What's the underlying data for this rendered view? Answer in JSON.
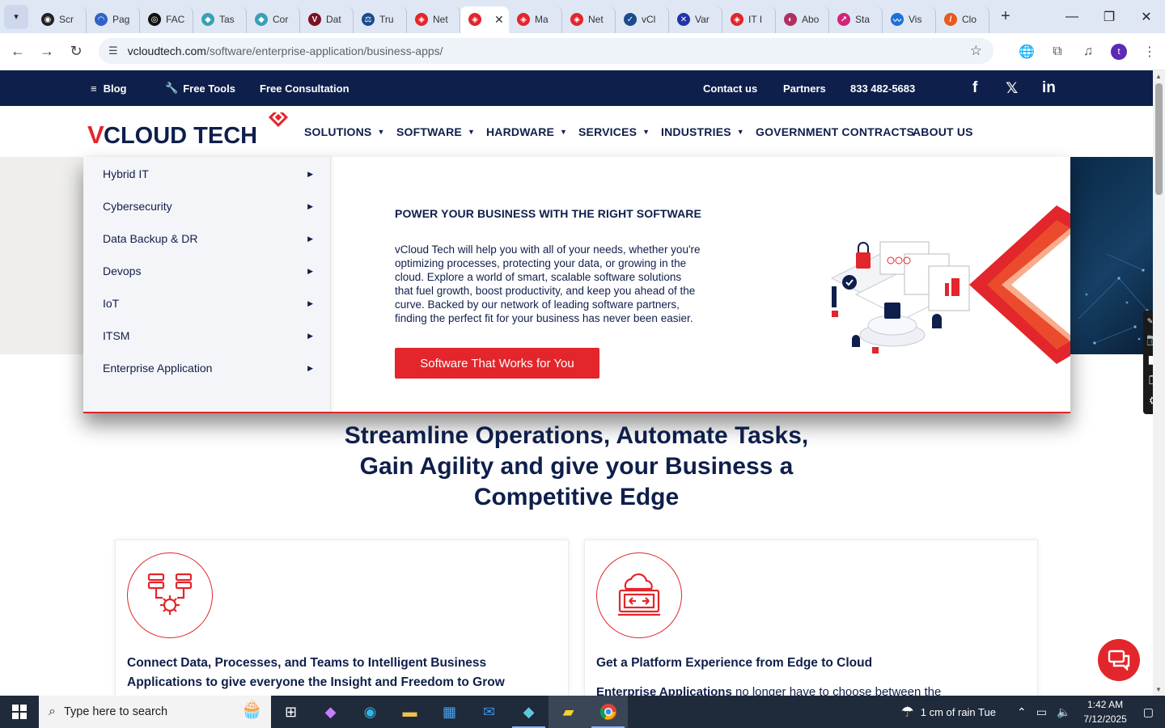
{
  "browser": {
    "tabs": [
      {
        "label": "Scr",
        "color": "#222222",
        "glyph": "◉"
      },
      {
        "label": "Pag",
        "color": "#2f63c9",
        "glyph": "◠"
      },
      {
        "label": "FAC",
        "color": "#111111",
        "glyph": "◎"
      },
      {
        "label": "Tas",
        "color": "#3aa0b5",
        "glyph": "◆"
      },
      {
        "label": "Cor",
        "color": "#3aa0b5",
        "glyph": "◆"
      },
      {
        "label": "Dat",
        "color": "#7a1022",
        "glyph": "V"
      },
      {
        "label": "Tru",
        "color": "#1a4b8c",
        "glyph": "⚖"
      },
      {
        "label": "Net",
        "color": "#e2262b",
        "glyph": "◈"
      },
      {
        "label": "",
        "color": "#e2262b",
        "glyph": "◈",
        "active": true
      },
      {
        "label": "Ma",
        "color": "#e2262b",
        "glyph": "◈"
      },
      {
        "label": "Net",
        "color": "#e2262b",
        "glyph": "◈"
      },
      {
        "label": "vCl",
        "color": "#1a4b8c",
        "glyph": "✓"
      },
      {
        "label": "Var",
        "color": "#2233aa",
        "glyph": "✕"
      },
      {
        "label": "IT I",
        "color": "#e2262b",
        "glyph": "◈"
      },
      {
        "label": "Abo",
        "color": "#b03060",
        "glyph": "◐"
      },
      {
        "label": "Sta",
        "color": "#d4237a",
        "glyph": "↗"
      },
      {
        "label": "Vis",
        "color": "#1e6fd9",
        "glyph": "〰"
      },
      {
        "label": "Clo",
        "color": "#e85a1c",
        "glyph": "/"
      }
    ],
    "url_host": "vcloudtech.com",
    "url_path": "/software/enterprise-application/business-apps/",
    "profile_initial": "t"
  },
  "topbar": {
    "blog": "Blog",
    "free_tools": "Free Tools",
    "free_consultation": "Free Consultation",
    "contact": "Contact us",
    "partners": "Partners",
    "phone": "833 482-5683",
    "social": [
      "f",
      "𝕏",
      "in"
    ]
  },
  "logo": {
    "text_v": "V",
    "text_rest": "CLOUD TECH"
  },
  "nav": [
    {
      "label": "SOLUTIONS",
      "dropdown": true
    },
    {
      "label": "SOFTWARE",
      "dropdown": true
    },
    {
      "label": "HARDWARE",
      "dropdown": true
    },
    {
      "label": "SERVICES",
      "dropdown": true
    },
    {
      "label": "INDUSTRIES",
      "dropdown": true
    },
    {
      "label": "GOVERNMENT CONTRACTS",
      "dropdown": false
    },
    {
      "label": "ABOUT US",
      "dropdown": false
    }
  ],
  "mega_menu": {
    "items": [
      "Hybrid IT",
      "Cybersecurity",
      "Data Backup & DR",
      "Devops",
      "IoT",
      "ITSM",
      "Enterprise Application"
    ],
    "title": "POWER YOUR BUSINESS WITH THE RIGHT SOFTWARE",
    "body": "vCloud Tech will help you with all of your needs, whether you're optimizing processes, protecting your data, or growing in the cloud. Explore a world of smart, scalable software solutions that fuel growth, boost productivity, and keep you ahead of the curve. Backed by our network of leading software partners, finding the perfect fit for your business has never been easier.",
    "button": "Software That Works for You"
  },
  "headline": {
    "line1": "Streamline Operations, Automate Tasks,",
    "line2": "Gain Agility and give your Business a",
    "line3": "Competitive Edge"
  },
  "cards": [
    {
      "title": "Connect Data, Processes, and Teams to Intelligent Business Applications to give everyone the Insight and Freedom to Grow",
      "body_bold": "",
      "body": ""
    },
    {
      "title": "Get a Platform Experience from Edge to Cloud",
      "body_bold": "Enterprise Applications",
      "body": " no longer have to choose between the"
    }
  ],
  "taskbar": {
    "search_placeholder": "Type here to search",
    "weather": "1 cm of rain Tue",
    "time": "1:42 AM",
    "date": "7/12/2025"
  },
  "colors": {
    "brand_red": "#e2262b",
    "brand_navy": "#0f1f4b"
  }
}
